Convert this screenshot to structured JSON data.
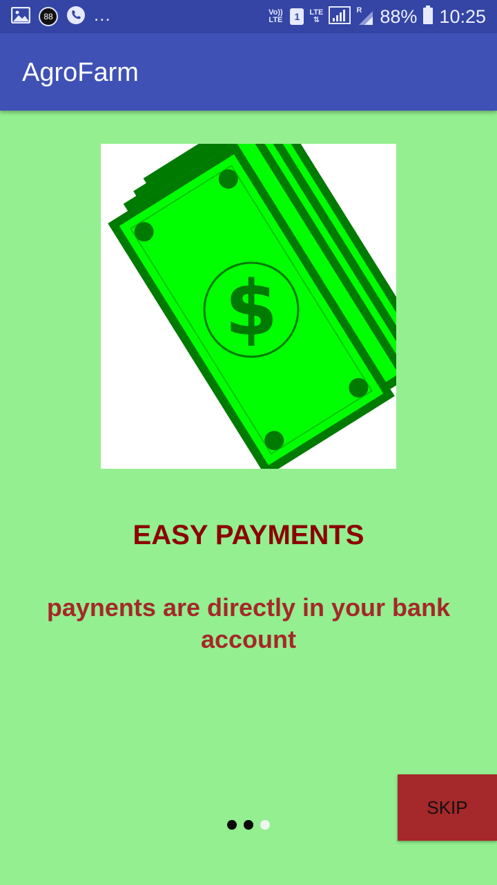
{
  "status_bar": {
    "notification_badge": "88",
    "more_indicator": "...",
    "volte_label": "Vo)) LTE",
    "sim_slot": "1",
    "network_label": "LTE",
    "roaming_label": "R",
    "battery_percent": "88%",
    "time": "10:25"
  },
  "app_bar": {
    "title": "AgroFarm"
  },
  "onboarding": {
    "illustration_icon": "money-stack-icon",
    "heading": "EASY PAYMENTS",
    "description": "paynents are directly in your bank account",
    "page_count": 3,
    "current_page": 3
  },
  "skip_button": {
    "label": "SKIP"
  },
  "colors": {
    "status_bar": "#3445a5",
    "app_bar": "#3f51b5",
    "background": "#93ef8f",
    "heading": "#8b0000",
    "description": "#a5282a",
    "skip_button": "#a5282a",
    "money_fill": "#00ff00",
    "money_border": "#007a00"
  }
}
